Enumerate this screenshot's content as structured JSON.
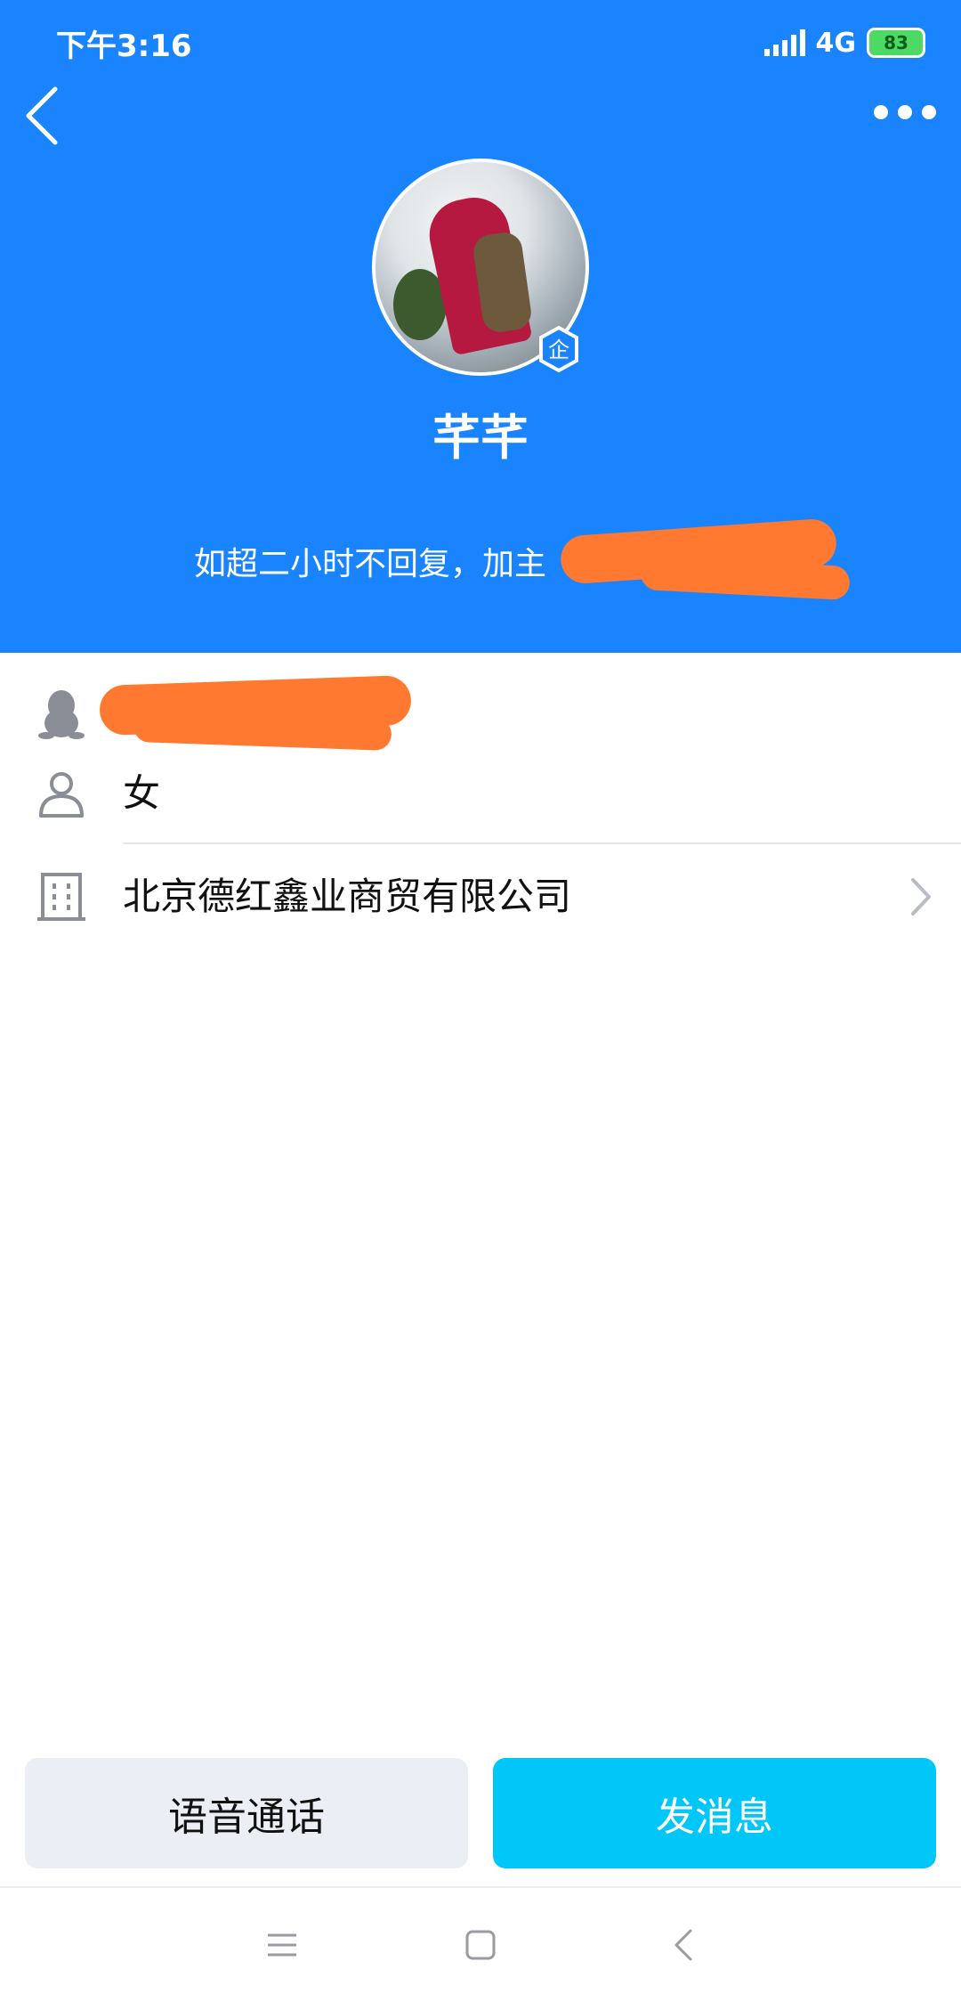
{
  "status_bar": {
    "time": "下午3:16",
    "network": "4G",
    "battery": "83"
  },
  "header": {
    "name": "芊芊",
    "signature": "如超二小时不回复，加主",
    "badge": "企"
  },
  "info": {
    "gender": "女",
    "company": "北京德红鑫业商贸有限公司"
  },
  "actions": {
    "voice_call": "语音通话",
    "send_message": "发消息"
  },
  "colors": {
    "header_bg": "#1a84ff",
    "primary": "#00c7f8",
    "redaction": "#ff7a30"
  }
}
